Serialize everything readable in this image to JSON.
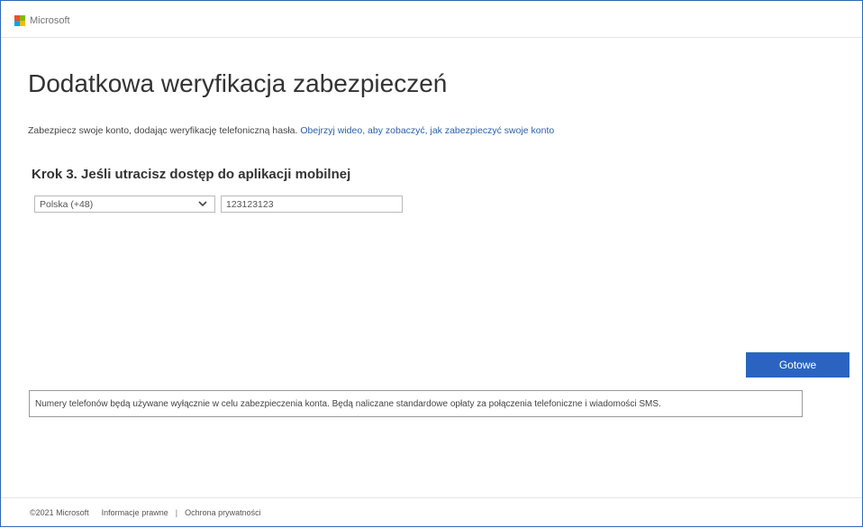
{
  "header": {
    "logo_text": "Microsoft",
    "logo_colors": [
      "#f25022",
      "#7fba00",
      "#00a4ef",
      "#ffb900"
    ]
  },
  "main": {
    "title": "Dodatkowa weryfikacja zabezpieczeń",
    "intro_text": "Zabezpiecz swoje konto, dodając weryfikację telefoniczną hasła.",
    "intro_link": "Obejrzyj wideo, aby zobaczyć, jak zabezpieczyć swoje konto",
    "step_title": "Krok 3. Jeśli utracisz dostęp do aplikacji mobilnej",
    "country_select": {
      "selected": "Polska (+48)",
      "icon": "chevron-down-icon"
    },
    "phone_input": {
      "value": "123123123"
    },
    "done_button_label": "Gotowe",
    "notice_text": "Numery telefonów będą używane wyłącznie w celu zabezpieczenia konta. Będą naliczane standardowe opłaty za połączenia telefoniczne i wiadomości SMS."
  },
  "footer": {
    "copyright": "©2021 Microsoft",
    "legal_link": "Informacje prawne",
    "separator": "|",
    "privacy_link": "Ochrona prywatności"
  },
  "colors": {
    "accent": "#2b64c0",
    "link": "#2a5fa8",
    "frame_border": "#2f67b6"
  }
}
